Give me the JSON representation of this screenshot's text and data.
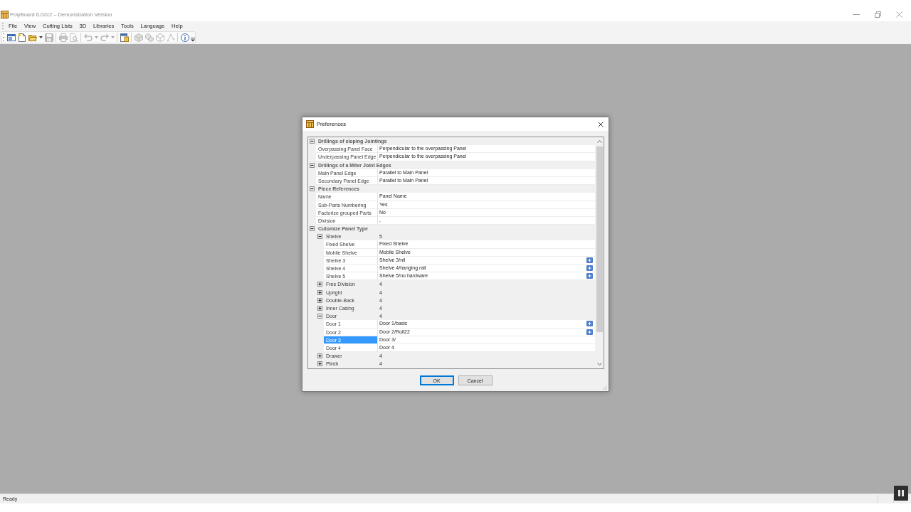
{
  "window": {
    "title": "PolyBoard 6.02c2 – Demonstration Version"
  },
  "menu_bar": [
    "File",
    "View",
    "Cutting Lists",
    "3D",
    "Libraries",
    "Tools",
    "Language",
    "Help"
  ],
  "toolbar": [
    {
      "kind": "window",
      "disabled": false,
      "dropdown": false
    },
    {
      "kind": "document",
      "disabled": false,
      "dropdown": false
    },
    {
      "kind": "folder",
      "disabled": false,
      "dropdown": true
    },
    {
      "kind": "floppy",
      "disabled": true,
      "dropdown": false
    },
    {
      "kind": "separator"
    },
    {
      "kind": "printer",
      "disabled": true,
      "dropdown": false
    },
    {
      "kind": "preview",
      "disabled": true,
      "dropdown": false
    },
    {
      "kind": "separator"
    },
    {
      "kind": "undo",
      "disabled": true,
      "dropdown": true
    },
    {
      "kind": "redo",
      "disabled": true,
      "dropdown": true
    },
    {
      "kind": "separator"
    },
    {
      "kind": "page",
      "disabled": false,
      "dropdown": false
    },
    {
      "kind": "separator"
    },
    {
      "kind": "cube",
      "disabled": true,
      "dropdown": false
    },
    {
      "kind": "cube-stack",
      "disabled": true,
      "dropdown": false
    },
    {
      "kind": "cube-outline",
      "disabled": true,
      "dropdown": false
    },
    {
      "kind": "nodes",
      "disabled": true,
      "dropdown": false
    },
    {
      "kind": "separator"
    },
    {
      "kind": "info",
      "disabled": false,
      "dropdown": false
    }
  ],
  "dialog": {
    "title": "Preferences",
    "property_grid": {
      "categories": [
        {
          "label": "Drillings of sloping Jointings",
          "expanded": true,
          "selected": false,
          "children": [
            {
              "kind": "property",
              "name": "Overpassing Panel Face",
              "value": "Perpendicular to the overpassing Panel",
              "selected": false,
              "editor_button": false
            },
            {
              "kind": "property",
              "name": "Underpassing Panel Edge",
              "value": "Perpendicular to the overpassing Panel",
              "selected": false,
              "editor_button": false
            }
          ]
        },
        {
          "label": "Drillings of a Miter Joint Edges",
          "expanded": true,
          "selected": false,
          "children": [
            {
              "kind": "property",
              "name": "Main Panel Edge",
              "value": "Parallel to Main Panel",
              "selected": false,
              "editor_button": false
            },
            {
              "kind": "property",
              "name": "Secondary Panel Edge",
              "value": "Parallel to Main Panel",
              "selected": false,
              "editor_button": false
            }
          ]
        },
        {
          "label": "Piece References",
          "expanded": true,
          "selected": false,
          "children": [
            {
              "kind": "property",
              "name": "Name",
              "value": "Panel Name",
              "selected": false,
              "editor_button": false
            },
            {
              "kind": "property",
              "name": "Sub-Parts Numbering",
              "value": "Yes",
              "selected": false,
              "editor_button": false
            },
            {
              "kind": "property",
              "name": "Factorize grouped Parts",
              "value": "No",
              "selected": false,
              "editor_button": false
            },
            {
              "kind": "property",
              "name": "Division",
              "value": ",",
              "selected": false,
              "editor_button": false
            }
          ]
        },
        {
          "label": "Cutomize Panel Type",
          "expanded": true,
          "selected": false,
          "children": [
            {
              "kind": "group",
              "name": "Shelve",
              "value": "5",
              "expanded": true,
              "selected": false,
              "children": [
                {
                  "kind": "property",
                  "name": "Fixed Shelve",
                  "value": "Fixed Shelve",
                  "selected": false,
                  "editor_button": false
                },
                {
                  "kind": "property",
                  "name": "Mobile Shelve",
                  "value": "Mobile Shelve",
                  "selected": false,
                  "editor_button": false
                },
                {
                  "kind": "property",
                  "name": "Shelve 3",
                  "value": "Shelve 3/nil",
                  "selected": false,
                  "editor_button": true
                },
                {
                  "kind": "property",
                  "name": "Shelve 4",
                  "value": "Shelve 4/hanging rail",
                  "selected": false,
                  "editor_button": true
                },
                {
                  "kind": "property",
                  "name": "Shelve 5",
                  "value": "Shelve 5/no hardware",
                  "selected": false,
                  "editor_button": true
                }
              ]
            },
            {
              "kind": "group",
              "name": "Free Division",
              "value": "4",
              "expanded": false,
              "selected": false
            },
            {
              "kind": "group",
              "name": "Upright",
              "value": "4",
              "expanded": false,
              "selected": false
            },
            {
              "kind": "group",
              "name": "Double-Back",
              "value": "4",
              "expanded": false,
              "selected": false
            },
            {
              "kind": "group",
              "name": "Inner Casing",
              "value": "4",
              "expanded": false,
              "selected": false
            },
            {
              "kind": "group",
              "name": "Door",
              "value": "4",
              "expanded": true,
              "selected": false,
              "children": [
                {
                  "kind": "property",
                  "name": "Door 1",
                  "value": "Door 1/basic",
                  "selected": false,
                  "editor_button": true
                },
                {
                  "kind": "property",
                  "name": "Door 2",
                  "value": "Door 2/Roll22",
                  "selected": false,
                  "editor_button": true
                },
                {
                  "kind": "property",
                  "name": "Door 3",
                  "value": "Door 3/",
                  "selected": true,
                  "editor_button": false
                },
                {
                  "kind": "property",
                  "name": "Door 4",
                  "value": "Door 4",
                  "selected": false,
                  "editor_button": false
                }
              ]
            },
            {
              "kind": "group",
              "name": "Drawer",
              "value": "4",
              "expanded": false,
              "selected": false
            },
            {
              "kind": "group",
              "name": "Plinth",
              "value": "4",
              "expanded": false,
              "selected": false
            }
          ]
        }
      ]
    },
    "buttons": [
      {
        "label": "OK",
        "default": true
      },
      {
        "label": "Cancel",
        "default": false
      }
    ]
  },
  "status_bar": {
    "text": "Ready"
  }
}
